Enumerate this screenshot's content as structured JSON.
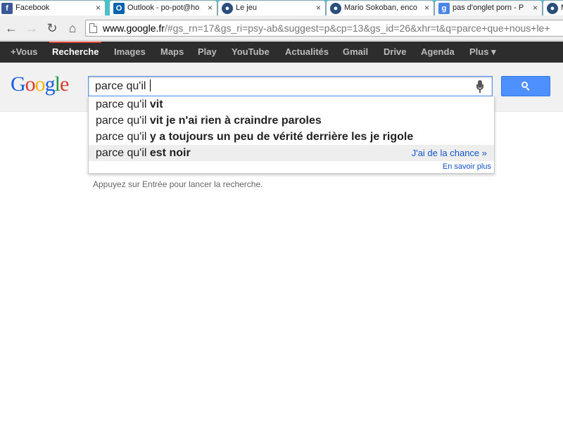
{
  "browser": {
    "tabs": [
      {
        "title": "Facebook",
        "icon": "facebook-icon",
        "fav": "f"
      },
      {
        "title": "Outlook - po-pot@ho",
        "icon": "outlook-icon",
        "fav": "O"
      },
      {
        "title": "Le jeu",
        "icon": "globe-icon",
        "fav": "●"
      },
      {
        "title": "Mario Sokoban, enco",
        "icon": "globe-icon",
        "fav": "●"
      },
      {
        "title": "pas d'onglet porn - P",
        "icon": "google-icon",
        "fav": "g"
      },
      {
        "title": "Ma",
        "icon": "globe-icon",
        "fav": "●"
      }
    ],
    "close_glyph": "×",
    "nav": {
      "back": "←",
      "forward": "→",
      "reload": "↻",
      "home": "⌂"
    },
    "url_host": "www.google.fr",
    "url_rest": "/#gs_rn=17&gs_ri=psy-ab&suggest=p&cp=13&gs_id=26&xhr=t&q=parce+que+nous+le+"
  },
  "gbar": {
    "items": [
      "+Vous",
      "Recherche",
      "Images",
      "Maps",
      "Play",
      "YouTube",
      "Actualités",
      "Gmail",
      "Drive",
      "Agenda",
      "Plus ▾"
    ]
  },
  "logo": {
    "letters": [
      {
        "ch": "G",
        "color": "#1a5ee6"
      },
      {
        "ch": "o",
        "color": "#dd3b2a"
      },
      {
        "ch": "o",
        "color": "#f2b50f"
      },
      {
        "ch": "g",
        "color": "#1a5ee6"
      },
      {
        "ch": "l",
        "color": "#1a9b3c"
      },
      {
        "ch": "e",
        "color": "#dd3b2a"
      }
    ]
  },
  "search": {
    "query": "parce qu'il "
  },
  "suggestions": [
    {
      "prefix": "parce qu'il ",
      "completion": "vit"
    },
    {
      "prefix": "parce qu'il ",
      "completion": "vit je n'ai rien à craindre paroles"
    },
    {
      "prefix": "parce qu'il ",
      "completion": "y a toujours un peu de vérité derrière les je rigole"
    },
    {
      "prefix": "parce qu'il ",
      "completion": "est noir"
    }
  ],
  "lucky_label": "J'ai de la chance »",
  "learn_more": "En savoir plus",
  "hint": "Appuyez sur Entrée pour lancer la recherche.",
  "colors": {
    "accent": "#4d90fe",
    "tabstrip": "#3ec8cd",
    "gbar": "#2d2d2d",
    "link": "#1155cc"
  }
}
